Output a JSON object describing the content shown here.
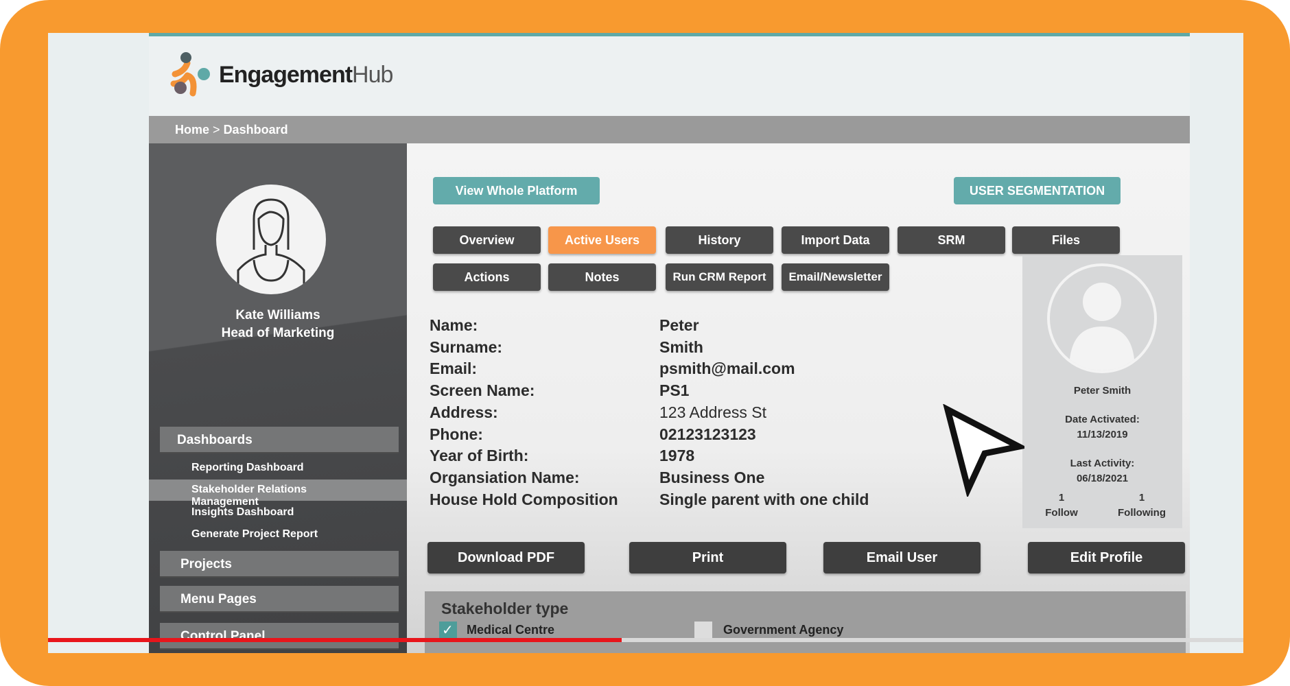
{
  "app": {
    "logo_main": "Engagement",
    "logo_sub": "Hub"
  },
  "breadcrumb": {
    "home": "Home",
    "separator": ">",
    "current": "Dashboard"
  },
  "user": {
    "name": "Kate Williams",
    "title": "Head of Marketing"
  },
  "sidebar": {
    "dashboards": "Dashboards",
    "items": [
      {
        "label": "Reporting Dashboard"
      },
      {
        "label": "Stakeholder Relations Management",
        "selected": true
      },
      {
        "label": "Insights Dashboard"
      },
      {
        "label": "Generate Project Report"
      }
    ],
    "projects": "Projects",
    "menu_pages": "Menu Pages",
    "control_panel": "Control Panel"
  },
  "top_buttons": {
    "view_platform": "View Whole Platform",
    "segmentation": "USER SEGMENTATION"
  },
  "tabs": [
    {
      "label": "Overview"
    },
    {
      "label": "Active Users",
      "active": true
    },
    {
      "label": "History"
    },
    {
      "label": "Import Data"
    },
    {
      "label": "SRM"
    },
    {
      "label": "Files"
    },
    {
      "label": "Actions"
    },
    {
      "label": "Notes"
    },
    {
      "label": "Run CRM Report"
    },
    {
      "label": "Email/Newsletter"
    }
  ],
  "profile_fields": [
    {
      "label": "Name:",
      "value": "Peter"
    },
    {
      "label": "Surname:",
      "value": "Smith"
    },
    {
      "label": "Email:",
      "value": "psmith@mail.com"
    },
    {
      "label": "Screen Name:",
      "value": "PS1"
    },
    {
      "label": "Address:",
      "value": "123 Address St"
    },
    {
      "label": "Phone:",
      "value": "02123123123"
    },
    {
      "label": "Year of Birth:",
      "value": "1978"
    },
    {
      "label": "Organsiation Name:",
      "value": "Business One"
    },
    {
      "label": "House Hold Composition",
      "value": "Single parent with one child"
    }
  ],
  "card": {
    "name": "Peter Smith",
    "date_activated_label": "Date Activated:",
    "date_activated": "11/13/2019",
    "last_activity_label": "Last Activity:",
    "last_activity": "06/18/2021",
    "follow_count": "1",
    "follow_label": "Follow",
    "following_count": "1",
    "following_label": "Following"
  },
  "actions": {
    "download": "Download PDF",
    "print": "Print",
    "email": "Email User",
    "edit": "Edit Profile"
  },
  "stakeholder": {
    "title": "Stakeholder type",
    "options": [
      {
        "label": "Medical Centre",
        "checked": true
      },
      {
        "label": "Government Agency",
        "checked": false
      }
    ]
  },
  "video": {
    "progress": 0.48
  },
  "colors": {
    "frame": "#f89a2f",
    "teal": "#63abab",
    "active_tab": "#f7964a",
    "progress": "#e8151b"
  }
}
